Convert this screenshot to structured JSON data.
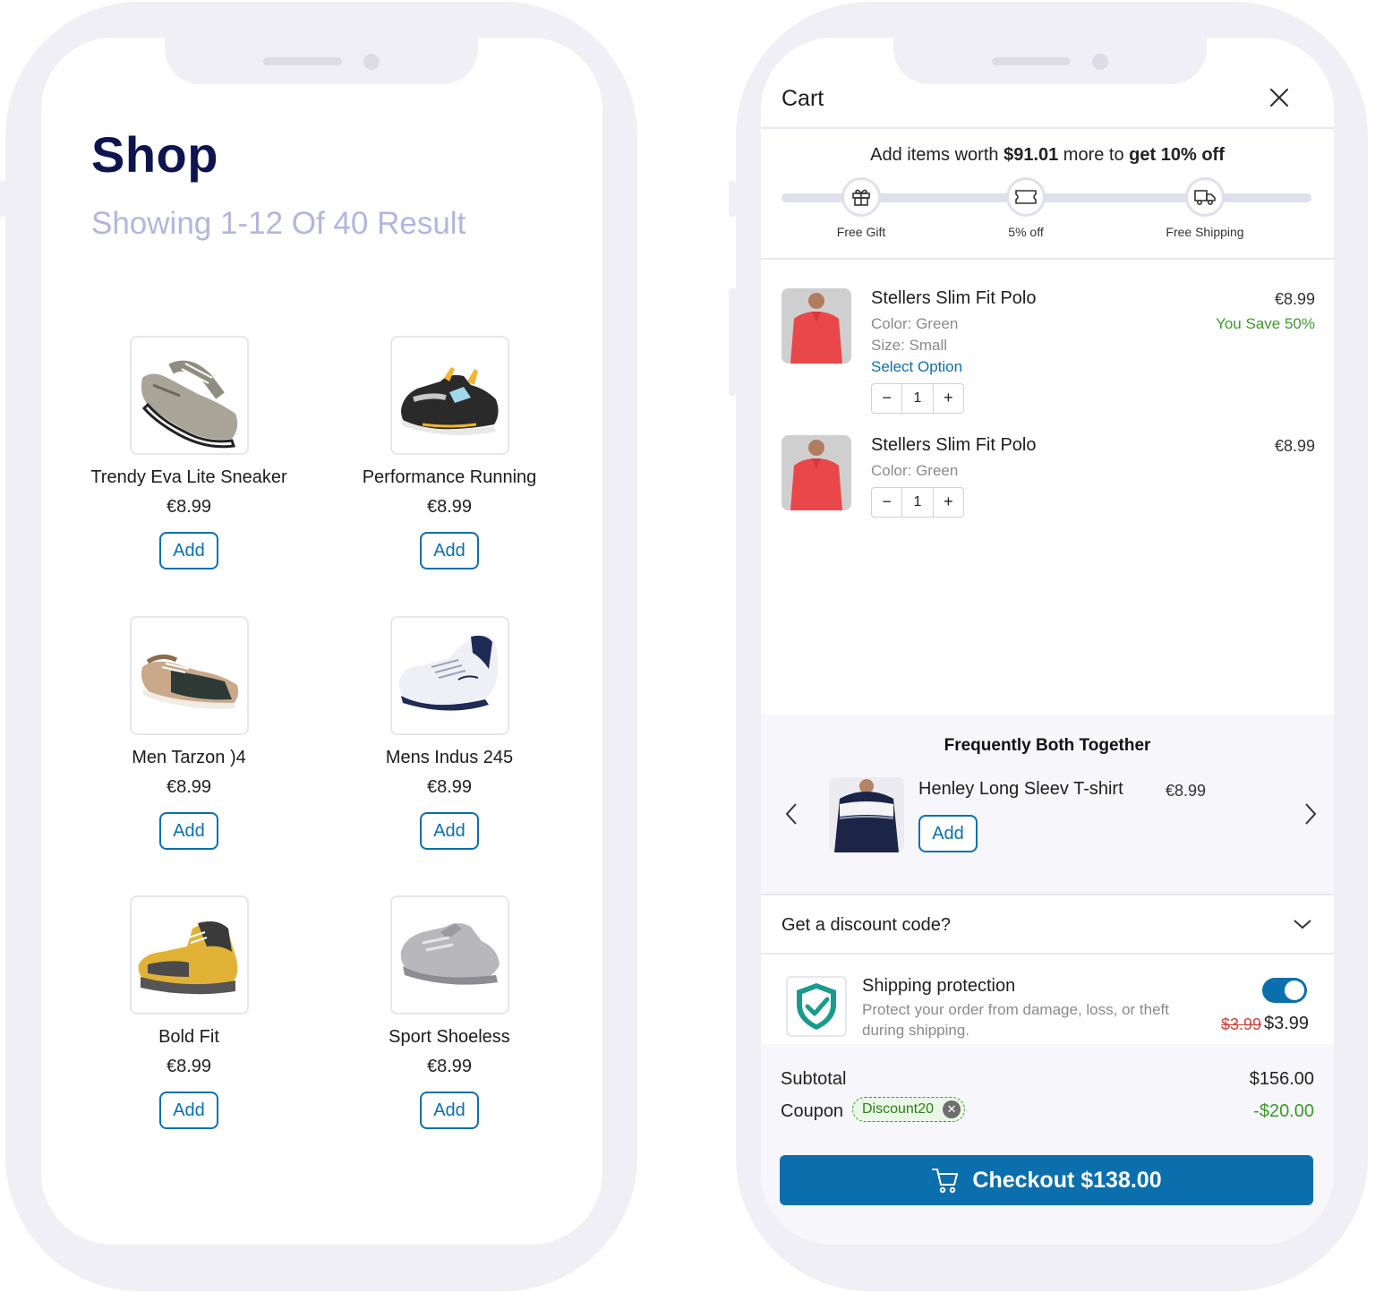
{
  "shop": {
    "title": "Shop",
    "subtitle": "Showing 1-12 Of 40 Result",
    "add_label": "Add",
    "products": [
      {
        "name": "Trendy Eva Lite Sneaker",
        "price": "€8.99",
        "image": "grey-sneaker"
      },
      {
        "name": "Performance Running",
        "price": "€8.99",
        "image": "black-yellow-sneaker"
      },
      {
        "name": "Men Tarzon )4",
        "price": "€8.99",
        "image": "tan-black-sneaker"
      },
      {
        "name": "Mens Indus 245",
        "price": "€8.99",
        "image": "white-navy-sneaker"
      },
      {
        "name": "Bold Fit",
        "price": "€8.99",
        "image": "yellow-hiking-boot"
      },
      {
        "name": "Sport Shoeless",
        "price": "€8.99",
        "image": "grey-strap-sneaker"
      }
    ]
  },
  "cart": {
    "title": "Cart",
    "close_icon": "close-icon",
    "promo": {
      "prefix": "Add items worth ",
      "amount": "$91.01",
      "middle": " more to ",
      "reward": "get 10% off"
    },
    "milestones": [
      {
        "label": "Free Gift",
        "icon": "gift-icon"
      },
      {
        "label": "5% off",
        "icon": "ticket-icon"
      },
      {
        "label": "Free Shipping",
        "icon": "truck-icon"
      }
    ],
    "items": [
      {
        "name": "Stellers Slim Fit Polo",
        "price": "€8.99",
        "savings": "You Save 50%",
        "color": "Color: Green",
        "size": "Size: Small",
        "select_option": "Select Option",
        "quantity": "1"
      },
      {
        "name": "Stellers Slim Fit Polo",
        "price": "€8.99",
        "color": "Color: Green",
        "quantity": "1"
      }
    ],
    "stepper": {
      "minus": "−",
      "plus": "+"
    },
    "frequently_bought": {
      "title": "Frequently Both Together",
      "product_name": "Henley Long Sleev T-shirt",
      "price": "€8.99",
      "add_label": "Add"
    },
    "discount_prompt": "Get a discount code?",
    "shipping_protection": {
      "title": "Shipping protection",
      "description": "Protect your order from damage, loss, or theft during shipping.",
      "old_price": "$3.99",
      "price": "$3.99",
      "enabled": true
    },
    "subtotal_label": "Subtotal",
    "subtotal": "$156.00",
    "coupon_label": "Coupon",
    "coupon_code": "Discount20",
    "coupon_discount": "-$20.00",
    "checkout_label": "Checkout $138.00"
  },
  "colors": {
    "brand_blue": "#0b6fae",
    "heading_navy": "#0d1450",
    "subtitle_lavender": "#b3b6dc",
    "savings_green": "#3b9a2b",
    "strike_red": "#d3403a",
    "frame_grey": "#efeff5"
  }
}
